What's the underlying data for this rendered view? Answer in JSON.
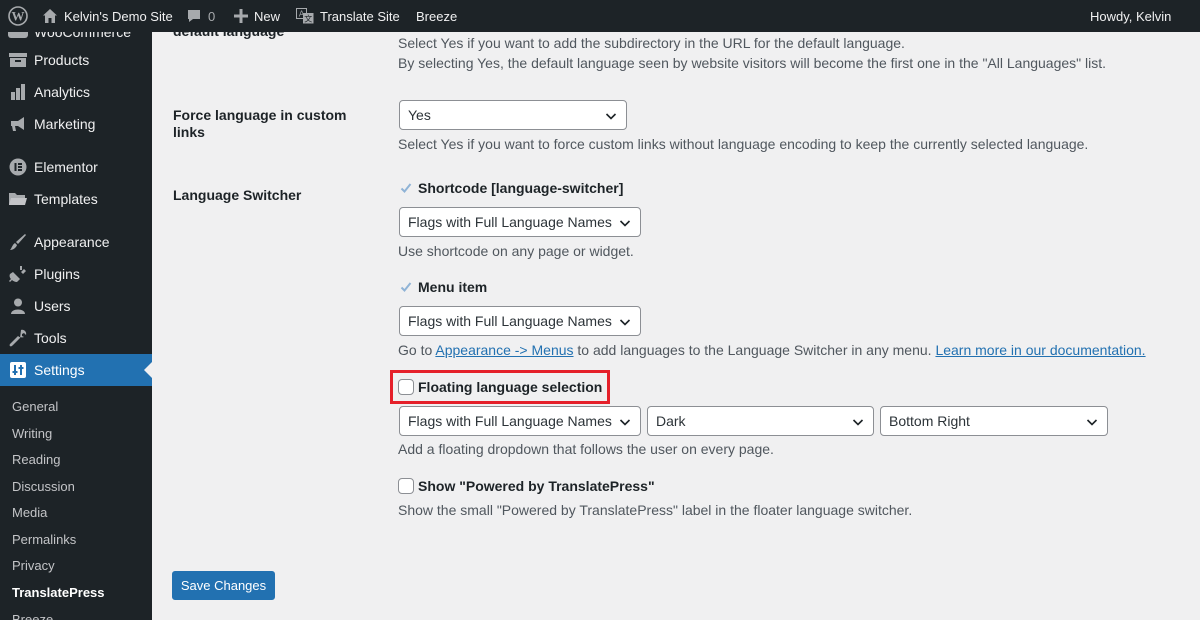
{
  "adminbar": {
    "site_name": "Kelvin's Demo Site",
    "comments_count": "0",
    "new_label": "New",
    "translate_label": "Translate Site",
    "breeze_label": "Breeze",
    "howdy": "Howdy, Kelvin"
  },
  "sidebar": {
    "cut_top_label": "WooCommerce",
    "items": [
      {
        "label": "Products",
        "icon": "archive-icon"
      },
      {
        "label": "Analytics",
        "icon": "bar-chart-icon"
      },
      {
        "label": "Marketing",
        "icon": "megaphone-icon"
      },
      {
        "label": "Elementor",
        "icon": "elementor-icon"
      },
      {
        "label": "Templates",
        "icon": "folder-icon"
      },
      {
        "label": "Appearance",
        "icon": "paintbrush-icon"
      },
      {
        "label": "Plugins",
        "icon": "plug-icon"
      },
      {
        "label": "Users",
        "icon": "user-icon"
      },
      {
        "label": "Tools",
        "icon": "wrench-icon"
      },
      {
        "label": "Settings",
        "icon": "settings-sliders-icon"
      }
    ],
    "submenu": [
      "General",
      "Writing",
      "Reading",
      "Discussion",
      "Media",
      "Permalinks",
      "Privacy",
      "TranslatePress",
      "Breeze"
    ]
  },
  "main": {
    "cut_top_label": "default language",
    "subdirectory_desc_1": "Select Yes if you want to add the subdirectory in the URL for the default language.",
    "subdirectory_desc_2": "By selecting Yes, the default language seen by website visitors will become the first one in the \"All Languages\" list.",
    "force_label_line1": "Force language in custom",
    "force_label_line2": "links",
    "force_select": "Yes",
    "force_desc": "Select Yes if you want to force custom links without language encoding to keep the currently selected language.",
    "switcher_label": "Language Switcher",
    "shortcode_label": "Shortcode [language-switcher]",
    "shortcode_select": "Flags with Full Language Names",
    "shortcode_desc": "Use shortcode on any page or widget.",
    "menu_item_label": "Menu item",
    "menu_item_select": "Flags with Full Language Names",
    "menu_desc_prefix": "Go to",
    "menu_desc_link": "Appearance -> Menus",
    "menu_desc_mid": "to add languages to the Language Switcher in any menu.",
    "menu_desc_doc_link": "Learn more in our documentation.",
    "floating_label": "Floating language selection",
    "floating_select_1": "Flags with Full Language Names",
    "floating_select_2": "Dark",
    "floating_select_3": "Bottom Right",
    "floating_desc": "Add a floating dropdown that follows the user on every page.",
    "powered_label": "Show \"Powered by TranslatePress\"",
    "powered_desc": "Show the small \"Powered by TranslatePress\" label in the floater language switcher.",
    "save_button": "Save Changes"
  },
  "colors": {
    "admin_bg": "#1d2327",
    "accent": "#2271b1",
    "highlight_red": "#e5202a"
  }
}
